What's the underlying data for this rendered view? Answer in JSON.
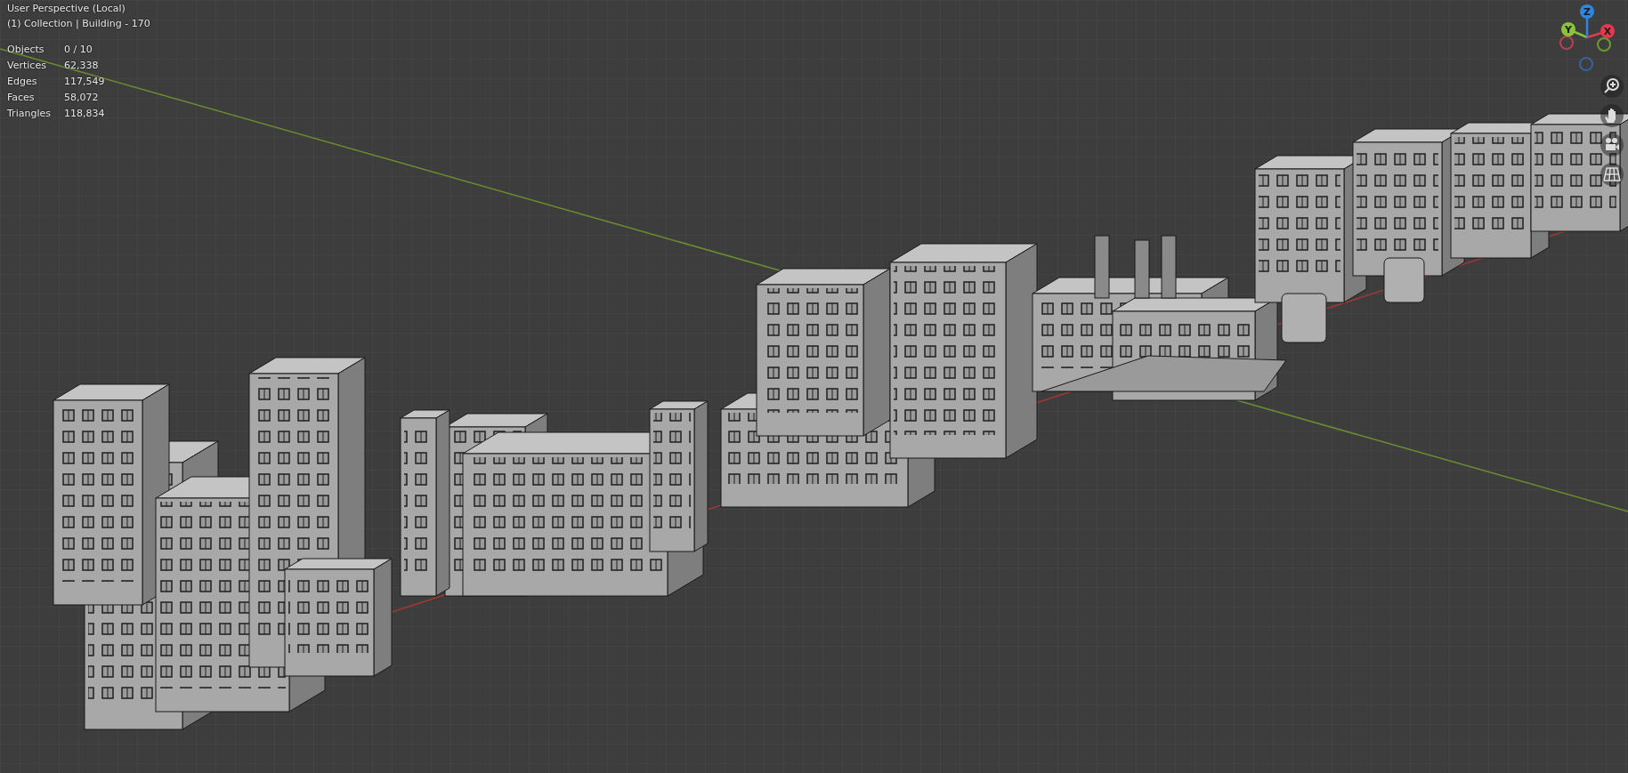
{
  "viewport": {
    "title": "User Perspective (Local)",
    "subtitle": "(1) Collection | Building - 170"
  },
  "stats": [
    {
      "label": "Objects",
      "value": "0 / 10"
    },
    {
      "label": "Vertices",
      "value": "62,338"
    },
    {
      "label": "Edges",
      "value": "117,549"
    },
    {
      "label": "Faces",
      "value": "58,072"
    },
    {
      "label": "Triangles",
      "value": "118,834"
    }
  ],
  "gizmo": {
    "axes": [
      {
        "kind": "negative",
        "color": "#b8424f"
      },
      {
        "kind": "negative",
        "color": "#6d9a2e"
      },
      {
        "kind": "negative",
        "color": "#35639c"
      },
      {
        "kind": "positive",
        "label": "Y",
        "color": "#8bc43a"
      },
      {
        "kind": "positive",
        "label": "X",
        "color": "#e2394f"
      },
      {
        "kind": "positive",
        "label": "Z",
        "color": "#2e86de"
      }
    ]
  }
}
